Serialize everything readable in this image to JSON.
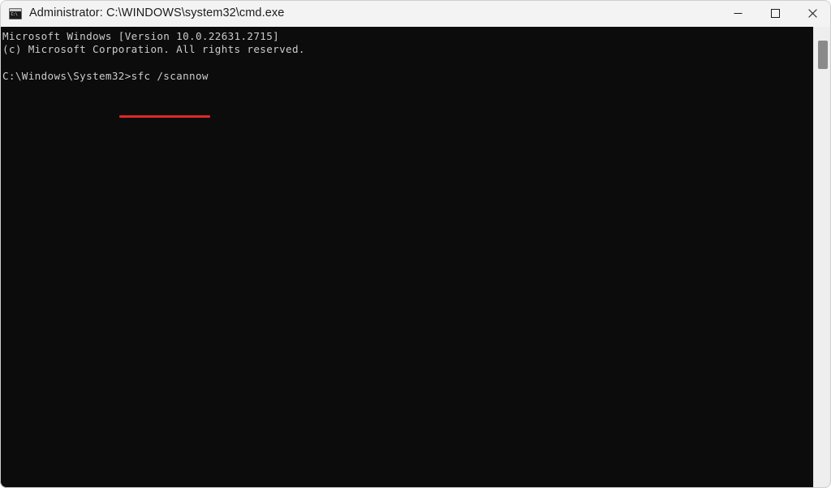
{
  "window": {
    "title": "Administrator: C:\\WINDOWS\\system32\\cmd.exe",
    "icon": "console-window-icon",
    "icon_glyph": "C:\\"
  },
  "titlebar": {
    "minimize_label": "—",
    "maximize_label": "❑",
    "close_label": "✕",
    "minimize_name": "minimize-button",
    "maximize_name": "maximize-button",
    "close_name": "close-button"
  },
  "console": {
    "background_color": "#0c0c0c",
    "foreground_color": "#cccccc",
    "lines": [
      "Microsoft Windows [Version 10.0.22631.2715]",
      "(c) Microsoft Corporation. All rights reserved.",
      "",
      "C:\\Windows\\System32>sfc /scannow"
    ],
    "text": "Microsoft Windows [Version 10.0.22631.2715]\n(c) Microsoft Corporation. All rights reserved.\n\nC:\\Windows\\System32>sfc /scannow",
    "prompt": "C:\\Windows\\System32>",
    "command": "sfc /scannow",
    "os_name": "Microsoft Windows",
    "os_version": "10.0.22631.2715",
    "copyright": "(c) Microsoft Corporation. All rights reserved."
  },
  "annotation": {
    "type": "underline",
    "color": "#e02828",
    "target_text": "sfc /scannow"
  },
  "scrollbar": {
    "track_color": "#eeeeee",
    "thumb_color": "#8a8a8a"
  }
}
